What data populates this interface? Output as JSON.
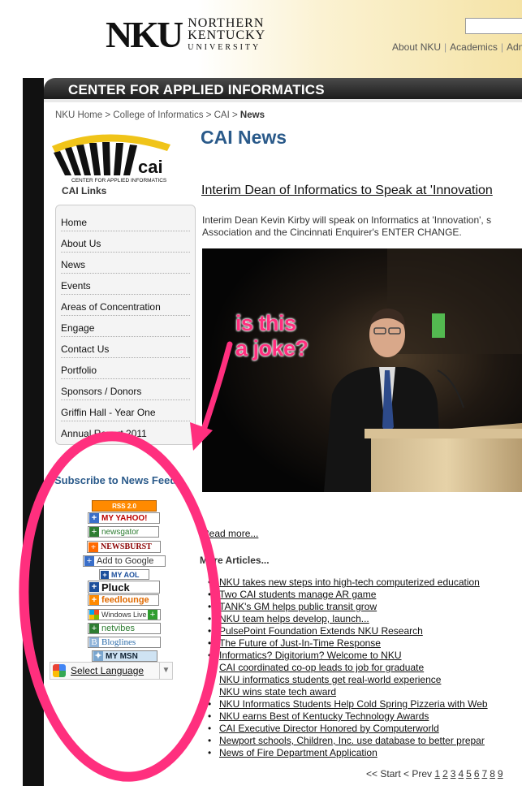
{
  "header": {
    "logo_mark": "NKU",
    "logo_line1": "NORTHERN",
    "logo_line2": "KENTUCKY",
    "logo_line3": "UNIVERSITY",
    "top_nav": [
      "About NKU",
      "Academics",
      "Adm"
    ]
  },
  "banner": {
    "title": "CENTER FOR APPLIED INFORMATICS"
  },
  "breadcrumb": {
    "items": [
      "NKU Home",
      "College of Informatics",
      "CAI"
    ],
    "current": "News",
    "separator": ">"
  },
  "sidebar": {
    "logo_text": "cai",
    "logo_subtext": "CENTER FOR APPLIED INFORMATICS",
    "links_title": "CAI Links",
    "links": [
      "Home",
      "About Us",
      "News",
      "Events",
      "Areas of Concentration",
      "Engage",
      "Contact Us",
      "Portfolio",
      "Sponsors / Donors",
      "Griffin Hall - Year One",
      "Annual Report 2011"
    ],
    "subscribe_title": "Subscribe to News Feed",
    "feeds": [
      {
        "label": "RSS 2.0",
        "bg": "#ff8a00"
      },
      {
        "label": "MY YAHOO!",
        "bg": "#ffffff"
      },
      {
        "label": "newsgator",
        "bg": "#ffffff"
      },
      {
        "label": "NEWSBURST",
        "bg": "#ffffff"
      },
      {
        "label": "Add to Google",
        "bg": "#ffffff"
      },
      {
        "label": "MY AOL",
        "bg": "#ffffff"
      },
      {
        "label": "Pluck",
        "bg": "#ffffff"
      },
      {
        "label": "feedlounge",
        "bg": "#ffffff"
      },
      {
        "label": "Windows Live",
        "bg": "#ffffff"
      },
      {
        "label": "netvibes",
        "bg": "#ffffff"
      },
      {
        "label": "Bloglines",
        "bg": "#ffffff"
      },
      {
        "label": "MY MSN",
        "bg": "#d8e8f5"
      }
    ],
    "select_language": "Select Language"
  },
  "main": {
    "title": "CAI News",
    "article_title": "Interim Dean of Informatics to Speak at 'Innovation",
    "article_intro": "Interim Dean Kevin Kirby will speak on Informatics at 'Innovation', s Association and the Cincinnati Enquirer's ENTER CHANGE.",
    "read_more": "Read more...",
    "more_articles": "More Articles...",
    "articles": [
      "NKU takes new steps into high-tech computerized education",
      "Two CAI students manage AR game",
      "TANK's GM helps public transit grow",
      "NKU team helps develop, launch...",
      "PulsePoint Foundation Extends NKU Research",
      "The Future of Just-In-Time Response",
      "Informatics? Digitorium? Welcome to NKU",
      "CAI coordinated co-op leads to job for graduate",
      "NKU informatics students get real-world experience",
      "NKU wins state tech award",
      "NKU Informatics Students Help Cold Spring Pizzeria with Web",
      "NKU earns Best of Kentucky Technology Awards",
      "CAI Executive Director Honored by Computerworld",
      "Newport schools, Children, Inc. use database to better prepar",
      "News of Fire Department Application"
    ],
    "pager": {
      "prefix": "<< Start < Prev",
      "pages": [
        "1",
        "2",
        "3",
        "4",
        "5",
        "6",
        "7",
        "8",
        "9"
      ]
    }
  },
  "annotation": {
    "line1": "is this",
    "line2": "a joke?",
    "color": "#ff2f7e"
  }
}
